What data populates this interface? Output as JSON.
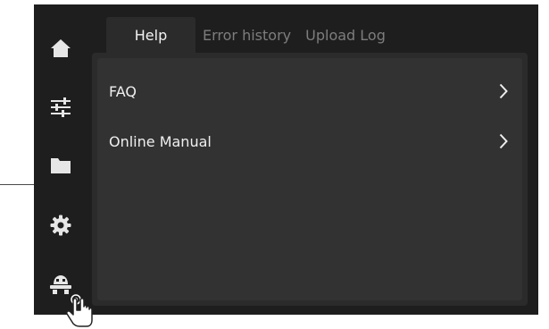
{
  "tabs": [
    {
      "label": "Help",
      "active": true
    },
    {
      "label": "Error history",
      "active": false
    },
    {
      "label": "Upload Log",
      "active": false
    }
  ],
  "sidebar": {
    "items": [
      {
        "icon": "home-icon"
      },
      {
        "icon": "sliders-icon"
      },
      {
        "icon": "folder-icon"
      },
      {
        "icon": "gear-icon"
      },
      {
        "icon": "robot-icon",
        "selected": true
      }
    ]
  },
  "help": {
    "items": [
      {
        "label": "FAQ",
        "icon": "chevron-right-icon"
      },
      {
        "label": "Online Manual",
        "icon": "chevron-right-icon"
      }
    ]
  },
  "colors": {
    "background": "#1e1e1e",
    "panel": "#2b2b2b",
    "text": "#efefef",
    "inactive_tab": "#7d7d7d"
  },
  "cursor": {
    "icon": "hand-pointer-icon"
  }
}
